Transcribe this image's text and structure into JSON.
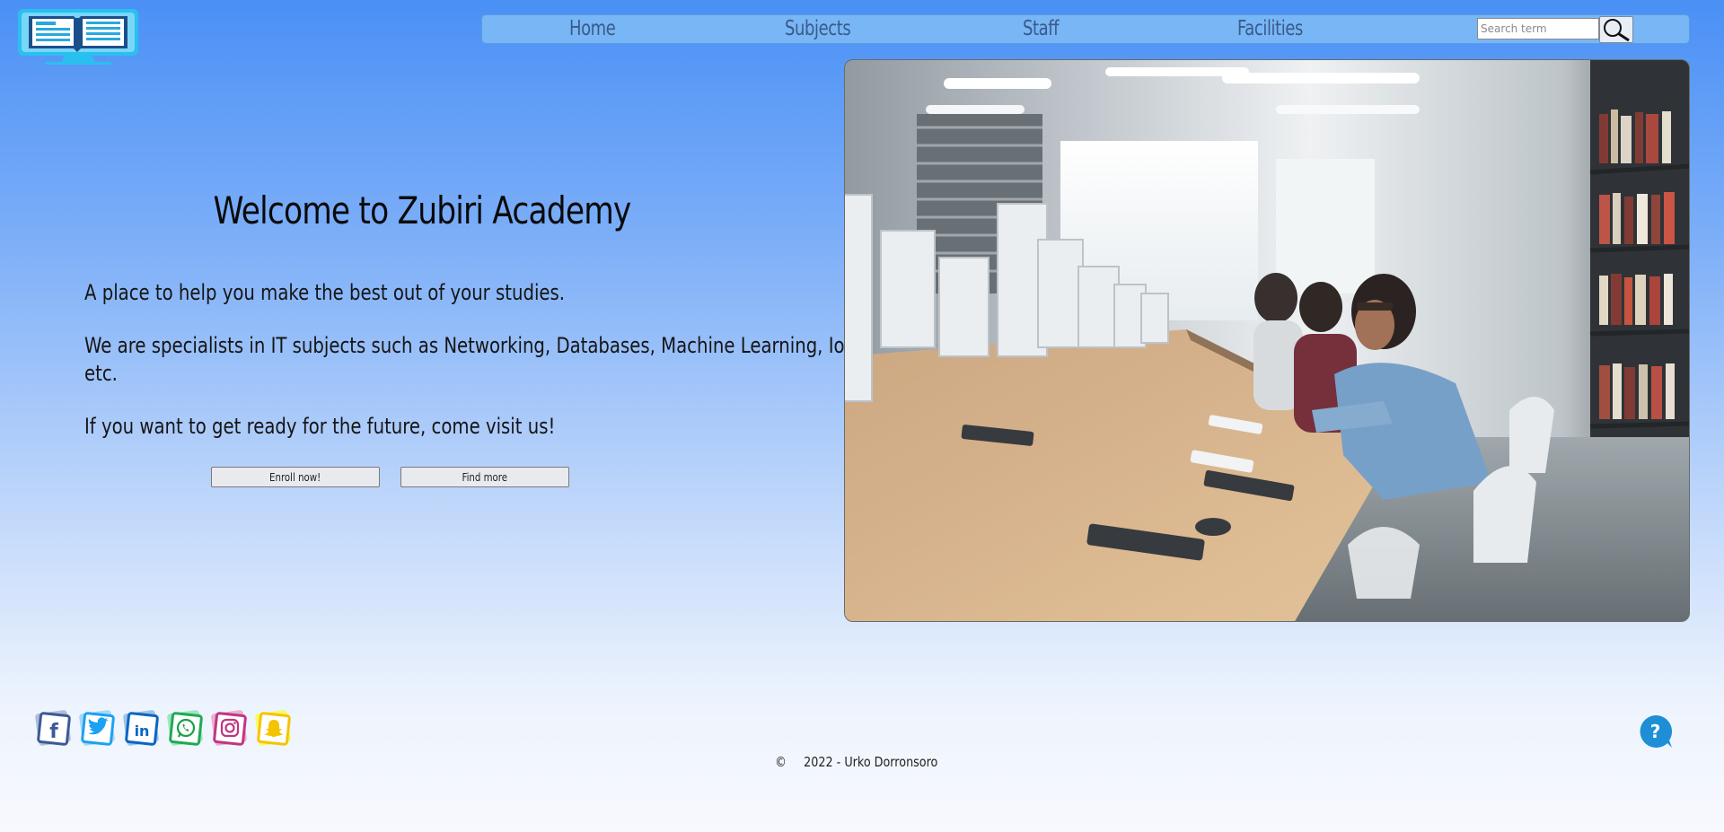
{
  "header": {
    "logo_icon": "open-book-monitor-icon",
    "nav": [
      "Home",
      "Subjects",
      "Staff",
      "Facilities"
    ],
    "search_placeholder": "Search term",
    "search_icon": "magnifier-icon"
  },
  "hero": {
    "title": "Welcome to Zubiri Academy",
    "paragraphs": [
      "A place to help you make the best out of your studies.",
      "We are specialists in IT subjects such as Networking, Databases, Machine Learning, IoT,",
      "etc.",
      "If you want to get ready for the future, come visit us!"
    ],
    "buttons": [
      "Enroll now!",
      "Find more"
    ]
  },
  "footer": {
    "social": [
      "facebook-icon",
      "twitter-icon",
      "linkedin-icon",
      "whatsapp-icon",
      "instagram-icon",
      "snapchat-icon"
    ],
    "copyright_symbol": "©",
    "copyright": "2022 - Urko Dorronsoro",
    "help_icon": "help-question-icon"
  },
  "colors": {
    "bg_top": "#4a90f5",
    "nav_bg": "#78b6f5",
    "nav_text": "#3a5a8a",
    "help": "#1e8fd6"
  }
}
